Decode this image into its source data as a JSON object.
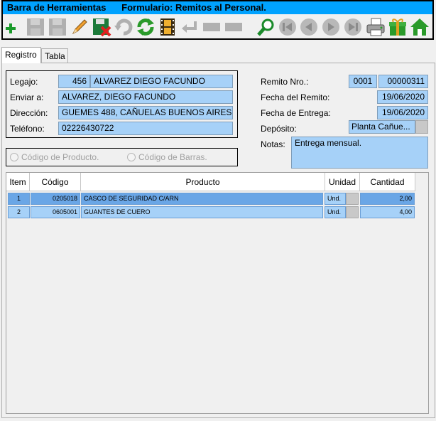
{
  "toolbar": {
    "title_bar": "Barra de Herramientas",
    "title_form": "Formulario: Remitos al Personal.",
    "buttons": [
      {
        "name": "add-icon",
        "enabled": true
      },
      {
        "name": "save-icon",
        "enabled": false
      },
      {
        "name": "save-as-icon",
        "enabled": false
      },
      {
        "name": "edit-icon",
        "enabled": true
      },
      {
        "name": "delete-icon",
        "enabled": true
      },
      {
        "name": "undo-icon",
        "enabled": false
      },
      {
        "name": "refresh-icon",
        "enabled": true
      },
      {
        "name": "film-icon",
        "enabled": true
      },
      {
        "name": "return-icon",
        "enabled": false
      },
      {
        "name": "blank-icon-1",
        "enabled": false
      },
      {
        "name": "blank-icon-2",
        "enabled": false
      },
      {
        "name": "search-icon",
        "enabled": true
      },
      {
        "name": "first-record-icon",
        "enabled": false
      },
      {
        "name": "previous-record-icon",
        "enabled": false
      },
      {
        "name": "next-record-icon",
        "enabled": false
      },
      {
        "name": "last-record-icon",
        "enabled": false
      },
      {
        "name": "print-icon",
        "enabled": true
      },
      {
        "name": "gift-icon",
        "enabled": true
      },
      {
        "name": "home-icon",
        "enabled": true
      }
    ]
  },
  "tabs": [
    {
      "label": "Registro",
      "active": true
    },
    {
      "label": "Tabla",
      "active": false
    }
  ],
  "form": {
    "legajo_label": "Legajo:",
    "legajo_number": "456",
    "legajo_name": "ALVAREZ DIEGO FACUNDO",
    "enviar_label": "Enviar a:",
    "enviar_value": "ALVAREZ, DIEGO FACUNDO",
    "direccion_label": "Dirección:",
    "direccion_value": "GUEMES 488, CAÑUELAS BUENOS AIRES",
    "telefono_label": "Teléfono:",
    "telefono_value": "02226430722",
    "remito_label": "Remito Nro.:",
    "remito_pto": "0001",
    "remito_nro": "00000311",
    "fecha_remito_label": "Fecha del Remito:",
    "fecha_remito_value": "19/06/2020",
    "fecha_entrega_label": "Fecha de Entrega:",
    "fecha_entrega_value": "19/06/2020",
    "deposito_label": "Depósito:",
    "deposito_value": "Planta Cañue...",
    "notas_label": "Notas:",
    "notas_value": "Entrega mensual.",
    "radio_producto": "Código de Producto.",
    "radio_barras": "Código de Barras."
  },
  "grid": {
    "headers": [
      "Item",
      "Código",
      "Producto",
      "Unidad",
      "Cantidad"
    ],
    "rows": [
      {
        "item": "1",
        "codigo": "0205018",
        "producto": "CASCO DE SEGURIDAD C/ARN",
        "unidad": "Und.",
        "cantidad": "2,00"
      },
      {
        "item": "2",
        "codigo": "0605001",
        "producto": "GUANTES DE CUERO",
        "unidad": "Und.",
        "cantidad": "4,00"
      }
    ]
  }
}
